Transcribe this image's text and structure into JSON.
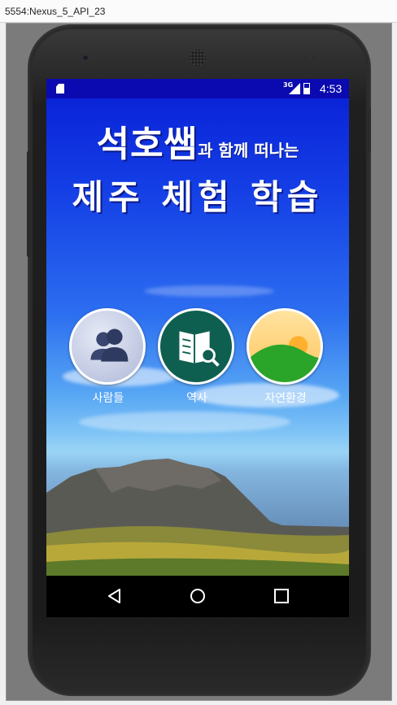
{
  "window": {
    "title": "5554:Nexus_5_API_23"
  },
  "statusbar": {
    "network": "3G",
    "time": "4:53"
  },
  "header": {
    "title_main": "석호쌤",
    "title_sub": "과 함께 떠나는",
    "title_line2": "제주 체험 학습"
  },
  "menu": [
    {
      "label": "사람들",
      "icon": "people-icon"
    },
    {
      "label": "역사",
      "icon": "book-search-icon"
    },
    {
      "label": "자연환경",
      "icon": "landscape-icon"
    }
  ],
  "colors": {
    "statusbar": "#0a0ab0",
    "sky_top": "#0a24d8",
    "people_bg": "#c9d0e8",
    "history_bg": "#0f6a58",
    "nature_sun": "#ffd27a",
    "nature_hill": "#2aa52a"
  }
}
